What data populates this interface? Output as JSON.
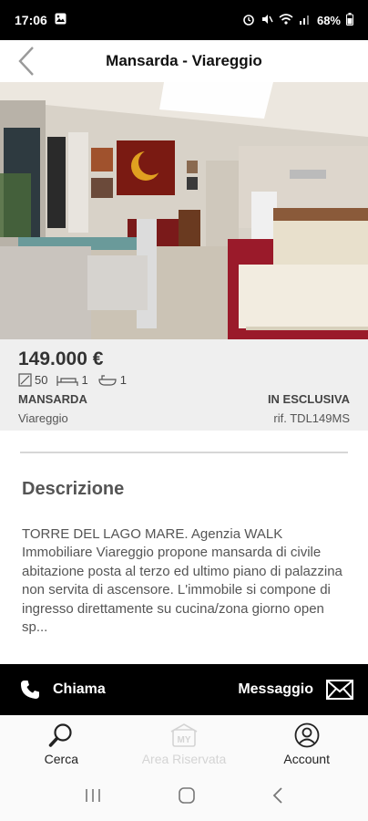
{
  "status": {
    "time": "17:06",
    "battery": "68%"
  },
  "header": {
    "title": "Mansarda - Viareggio"
  },
  "listing": {
    "price": "149.000 €",
    "area": "50",
    "bedrooms": "1",
    "bathrooms": "1",
    "type": "MANSARDA",
    "city": "Viareggio",
    "exclusive": "IN ESCLUSIVA",
    "reference": "rif. TDL149MS"
  },
  "description": {
    "title": "Descrizione",
    "text": "TORRE DEL LAGO MARE. Agenzia WALK Immobiliare Viareggio propone mansarda di civile abitazione posta al terzo ed ultimo piano di palazzina non servita di ascensore. L'immobile si compone di ingresso direttamente su cucina/zona giorno open sp..."
  },
  "actions": {
    "call_label": "Chiama",
    "message_label": "Messaggio"
  },
  "nav": {
    "items": [
      {
        "label": "Cerca",
        "icon": "search-icon"
      },
      {
        "label": "Area Riservata",
        "icon": "my-area-icon",
        "badge": "MY"
      },
      {
        "label": "Account",
        "icon": "account-icon"
      }
    ]
  },
  "colors": {
    "accent": "#000000",
    "info_bg": "#efefef",
    "disabled": "#d4d4d4"
  }
}
